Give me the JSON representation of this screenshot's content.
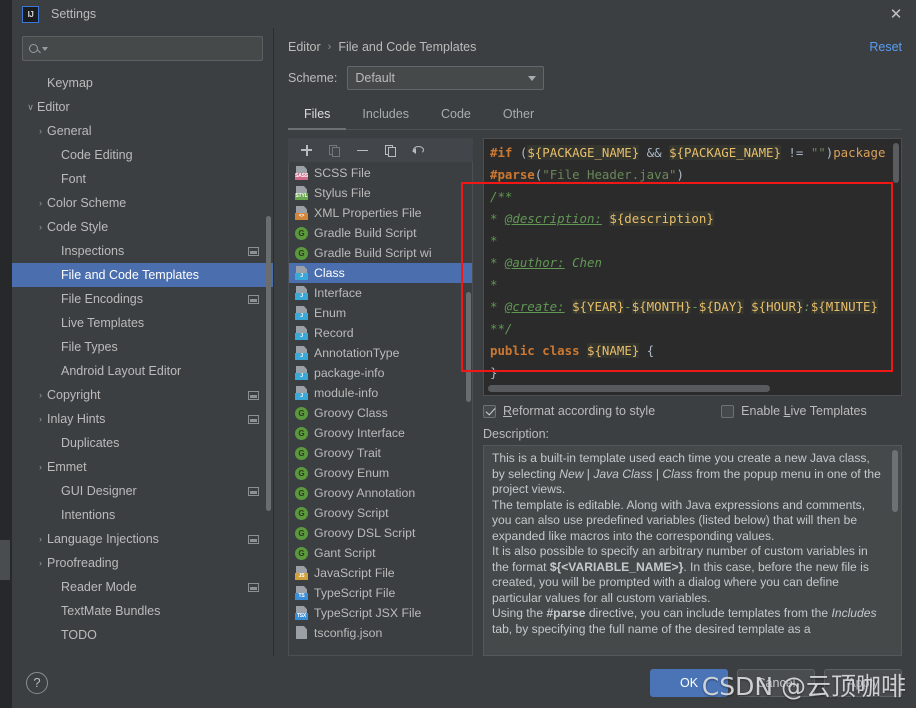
{
  "window": {
    "title": "Settings",
    "logo_text": "IJ",
    "close_icon": "close-icon"
  },
  "search": {
    "placeholder": "",
    "value": ""
  },
  "sidebar": {
    "items": [
      {
        "label": "Keymap",
        "depth": 1,
        "arrow": "",
        "badge": false,
        "selected": false
      },
      {
        "label": "Editor",
        "depth": 0,
        "arrow": "v",
        "badge": false,
        "selected": false
      },
      {
        "label": "General",
        "depth": 1,
        "arrow": ">",
        "badge": false,
        "selected": false
      },
      {
        "label": "Code Editing",
        "depth": 2,
        "arrow": "",
        "badge": false,
        "selected": false
      },
      {
        "label": "Font",
        "depth": 2,
        "arrow": "",
        "badge": false,
        "selected": false
      },
      {
        "label": "Color Scheme",
        "depth": 1,
        "arrow": ">",
        "badge": false,
        "selected": false
      },
      {
        "label": "Code Style",
        "depth": 1,
        "arrow": ">",
        "badge": false,
        "selected": false
      },
      {
        "label": "Inspections",
        "depth": 2,
        "arrow": "",
        "badge": true,
        "selected": false
      },
      {
        "label": "File and Code Templates",
        "depth": 2,
        "arrow": "",
        "badge": false,
        "selected": true
      },
      {
        "label": "File Encodings",
        "depth": 2,
        "arrow": "",
        "badge": true,
        "selected": false
      },
      {
        "label": "Live Templates",
        "depth": 2,
        "arrow": "",
        "badge": false,
        "selected": false
      },
      {
        "label": "File Types",
        "depth": 2,
        "arrow": "",
        "badge": false,
        "selected": false
      },
      {
        "label": "Android Layout Editor",
        "depth": 2,
        "arrow": "",
        "badge": false,
        "selected": false
      },
      {
        "label": "Copyright",
        "depth": 1,
        "arrow": ">",
        "badge": true,
        "selected": false
      },
      {
        "label": "Inlay Hints",
        "depth": 1,
        "arrow": ">",
        "badge": true,
        "selected": false
      },
      {
        "label": "Duplicates",
        "depth": 2,
        "arrow": "",
        "badge": false,
        "selected": false
      },
      {
        "label": "Emmet",
        "depth": 1,
        "arrow": ">",
        "badge": false,
        "selected": false
      },
      {
        "label": "GUI Designer",
        "depth": 2,
        "arrow": "",
        "badge": true,
        "selected": false
      },
      {
        "label": "Intentions",
        "depth": 2,
        "arrow": "",
        "badge": false,
        "selected": false
      },
      {
        "label": "Language Injections",
        "depth": 1,
        "arrow": ">",
        "badge": true,
        "selected": false
      },
      {
        "label": "Proofreading",
        "depth": 1,
        "arrow": ">",
        "badge": false,
        "selected": false
      },
      {
        "label": "Reader Mode",
        "depth": 2,
        "arrow": "",
        "badge": true,
        "selected": false
      },
      {
        "label": "TextMate Bundles",
        "depth": 2,
        "arrow": "",
        "badge": false,
        "selected": false
      },
      {
        "label": "TODO",
        "depth": 2,
        "arrow": "",
        "badge": false,
        "selected": false
      }
    ]
  },
  "header": {
    "breadcrumb_parent": "Editor",
    "breadcrumb_sep": "›",
    "breadcrumb_current": "File and Code Templates",
    "reset_label": "Reset",
    "scheme_label": "Scheme:",
    "scheme_value": "Default"
  },
  "tabs": [
    {
      "label": "Files",
      "active": true
    },
    {
      "label": "Includes",
      "active": false
    },
    {
      "label": "Code",
      "active": false
    },
    {
      "label": "Other",
      "active": false
    }
  ],
  "list_toolbar": [
    {
      "name": "add-template-icon",
      "kind": "plus",
      "enabled": true
    },
    {
      "name": "copy-template-icon",
      "kind": "pages",
      "enabled": false
    },
    {
      "name": "remove-template-icon",
      "kind": "minus",
      "enabled": true
    },
    {
      "name": "duplicate-template-icon",
      "kind": "pages",
      "enabled": true
    },
    {
      "name": "reset-template-icon",
      "kind": "undo",
      "enabled": true
    }
  ],
  "templates": [
    {
      "label": "SCSS File",
      "icon": "file-icon",
      "tag": "SASS",
      "tag_color": "#cf6a8a",
      "selected": false
    },
    {
      "label": "Stylus File",
      "icon": "file-icon",
      "tag": "STYL",
      "tag_color": "#6aa84f",
      "selected": false
    },
    {
      "label": "XML Properties File",
      "icon": "file-icon",
      "tag": "<>",
      "tag_color": "#d2853a",
      "selected": false
    },
    {
      "label": "Gradle Build Script",
      "icon": "groovy-icon",
      "tag": "G",
      "tag_color": "#5a9a3c",
      "selected": false
    },
    {
      "label": "Gradle Build Script wi",
      "icon": "groovy-icon",
      "tag": "G",
      "tag_color": "#5a9a3c",
      "selected": false
    },
    {
      "label": "Class",
      "icon": "java-icon",
      "tag": "J",
      "tag_color": "#3ba9d8",
      "selected": true
    },
    {
      "label": "Interface",
      "icon": "java-icon",
      "tag": "J",
      "tag_color": "#3ba9d8",
      "selected": false
    },
    {
      "label": "Enum",
      "icon": "java-icon",
      "tag": "J",
      "tag_color": "#3ba9d8",
      "selected": false
    },
    {
      "label": "Record",
      "icon": "java-icon",
      "tag": "J",
      "tag_color": "#3ba9d8",
      "selected": false
    },
    {
      "label": "AnnotationType",
      "icon": "java-icon",
      "tag": "J",
      "tag_color": "#3ba9d8",
      "selected": false
    },
    {
      "label": "package-info",
      "icon": "java-icon",
      "tag": "J",
      "tag_color": "#3ba9d8",
      "selected": false
    },
    {
      "label": "module-info",
      "icon": "java-icon",
      "tag": "J",
      "tag_color": "#3ba9d8",
      "selected": false
    },
    {
      "label": "Groovy Class",
      "icon": "groovy-icon",
      "tag": "G",
      "tag_color": "#5a9a3c",
      "selected": false
    },
    {
      "label": "Groovy Interface",
      "icon": "groovy-icon",
      "tag": "G",
      "tag_color": "#5a9a3c",
      "selected": false
    },
    {
      "label": "Groovy Trait",
      "icon": "groovy-icon",
      "tag": "G",
      "tag_color": "#5a9a3c",
      "selected": false
    },
    {
      "label": "Groovy Enum",
      "icon": "groovy-icon",
      "tag": "G",
      "tag_color": "#5a9a3c",
      "selected": false
    },
    {
      "label": "Groovy Annotation",
      "icon": "groovy-icon",
      "tag": "G",
      "tag_color": "#5a9a3c",
      "selected": false
    },
    {
      "label": "Groovy Script",
      "icon": "groovy-icon",
      "tag": "G",
      "tag_color": "#5a9a3c",
      "selected": false
    },
    {
      "label": "Groovy DSL Script",
      "icon": "groovy-icon",
      "tag": "G",
      "tag_color": "#5a9a3c",
      "selected": false
    },
    {
      "label": "Gant Script",
      "icon": "groovy-icon",
      "tag": "G",
      "tag_color": "#5a9a3c",
      "selected": false
    },
    {
      "label": "JavaScript File",
      "icon": "file-icon",
      "tag": "JS",
      "tag_color": "#d2a03a",
      "selected": false
    },
    {
      "label": "TypeScript File",
      "icon": "file-icon",
      "tag": "TS",
      "tag_color": "#3b8fd8",
      "selected": false
    },
    {
      "label": "TypeScript JSX File",
      "icon": "file-icon",
      "tag": "TSX",
      "tag_color": "#3b8fd8",
      "selected": false
    },
    {
      "label": "tsconfig.json",
      "icon": "file-icon",
      "tag": "",
      "tag_color": "#8d9093",
      "selected": false
    }
  ],
  "editor": {
    "lines": [
      [
        {
          "t": "#if",
          "c": "k-orange"
        },
        {
          "t": " (",
          "c": "k-plain"
        },
        {
          "t": "${PACKAGE_NAME}",
          "c": "k-var"
        },
        {
          "t": " && ",
          "c": "k-plain"
        },
        {
          "t": "${PACKAGE_NAME}",
          "c": "k-var"
        },
        {
          "t": " != ",
          "c": "k-plain"
        },
        {
          "t": "\"\"",
          "c": "k-str"
        },
        {
          "t": ")",
          "c": "k-plain"
        },
        {
          "t": "package",
          "c": "k-pkg"
        }
      ],
      [
        {
          "t": "#parse",
          "c": "k-orange"
        },
        {
          "t": "(",
          "c": "k-plain"
        },
        {
          "t": "\"File Header.java\"",
          "c": "k-str"
        },
        {
          "t": ")",
          "c": "k-plain"
        }
      ],
      [
        {
          "t": "/**",
          "c": "k-cmt"
        }
      ],
      [
        {
          "t": "* ",
          "c": "k-cmt"
        },
        {
          "t": "@description:",
          "c": "k-cmt-u"
        },
        {
          "t": " ",
          "c": "k-cmt"
        },
        {
          "t": "${description}",
          "c": "k-var"
        }
      ],
      [
        {
          "t": "*",
          "c": "k-cmt"
        }
      ],
      [
        {
          "t": "* ",
          "c": "k-cmt"
        },
        {
          "t": "@author:",
          "c": "k-cmt-u"
        },
        {
          "t": " Chen",
          "c": "k-cmt"
        }
      ],
      [
        {
          "t": "*",
          "c": "k-cmt"
        }
      ],
      [
        {
          "t": "* ",
          "c": "k-cmt"
        },
        {
          "t": "@create:",
          "c": "k-cmt-u"
        },
        {
          "t": " ",
          "c": "k-cmt"
        },
        {
          "t": "${YEAR}",
          "c": "k-var"
        },
        {
          "t": "-",
          "c": "k-cmt"
        },
        {
          "t": "${MONTH}",
          "c": "k-var"
        },
        {
          "t": "-",
          "c": "k-cmt"
        },
        {
          "t": "${DAY}",
          "c": "k-var"
        },
        {
          "t": " ",
          "c": "k-cmt"
        },
        {
          "t": "${HOUR}",
          "c": "k-var"
        },
        {
          "t": ":",
          "c": "k-cmt"
        },
        {
          "t": "${MINUTE}",
          "c": "k-var"
        }
      ],
      [
        {
          "t": "**/",
          "c": "k-cmt"
        }
      ],
      [
        {
          "t": "public",
          "c": "k-orange"
        },
        {
          "t": " ",
          "c": "k-plain"
        },
        {
          "t": "class",
          "c": "k-orange"
        },
        {
          "t": " ",
          "c": "k-plain"
        },
        {
          "t": "${NAME}",
          "c": "k-var"
        },
        {
          "t": " {",
          "c": "k-plain"
        }
      ],
      [
        {
          "t": "}",
          "c": "k-plain"
        }
      ]
    ]
  },
  "options": {
    "reformat_label_pre": "R",
    "reformat_label_post": "eformat according to style",
    "reformat_checked": true,
    "live_label_pre": "Enable ",
    "live_label_mnemonic": "L",
    "live_label_post": "ive Templates",
    "live_checked": false
  },
  "description": {
    "label": "Description:",
    "paragraphs": [
      "This is a built-in template used each time you create a new Java class, by selecting <i>New</i> | <i>Java Class</i> | <i>Class</i> from the popup menu in one of the project views.",
      "The template is editable. Along with Java expressions and comments, you can also use predefined variables (listed below) that will then be expanded like macros into the corresponding values.",
      "It is also possible to specify an arbitrary number of custom variables in the format <b>${&lt;VARIABLE_NAME&gt;}</b>. In this case, before the new file is created, you will be prompted with a dialog where you can define particular values for all custom variables.",
      "Using the <b>#parse</b> directive, you can include templates from the <i>Includes</i> tab, by specifying the full name of the desired template as a"
    ]
  },
  "footer": {
    "help_label": "?",
    "ok_label": "OK",
    "cancel_label": "Cancel",
    "apply_label": "Apply"
  },
  "watermark": {
    "text": "CSDN @云顶咖啡"
  },
  "colors": {
    "selection_blue": "#4b6eaf",
    "accent_link": "#589df6",
    "annotation_red": "#f21717",
    "primary_button": "#4a74b5"
  }
}
